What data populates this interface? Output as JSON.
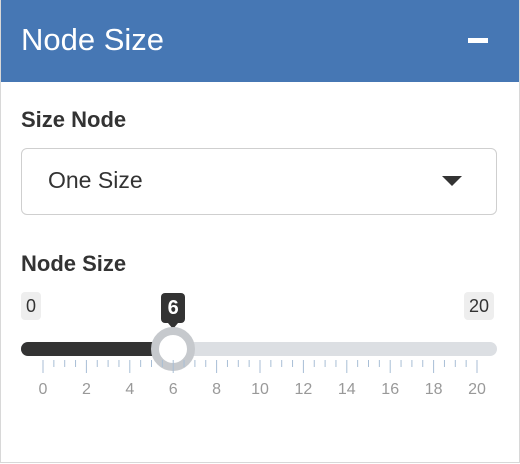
{
  "panel": {
    "title": "Node Size",
    "collapse_icon": "minus-icon"
  },
  "size_node": {
    "label": "Size Node",
    "selected": "One Size",
    "caret_icon": "caret-down-icon"
  },
  "node_size": {
    "label": "Node Size",
    "min_label": "0",
    "max_label": "20",
    "value_label": "6",
    "value": 6,
    "min": 0,
    "max": 20,
    "tick_labels": [
      "0",
      "2",
      "4",
      "6",
      "8",
      "10",
      "12",
      "14",
      "16",
      "18",
      "20"
    ]
  },
  "colors": {
    "header": "#4677b4",
    "slider_fill": "#333333",
    "slider_track": "#dcdfe3",
    "tick": "#a8bed6"
  }
}
